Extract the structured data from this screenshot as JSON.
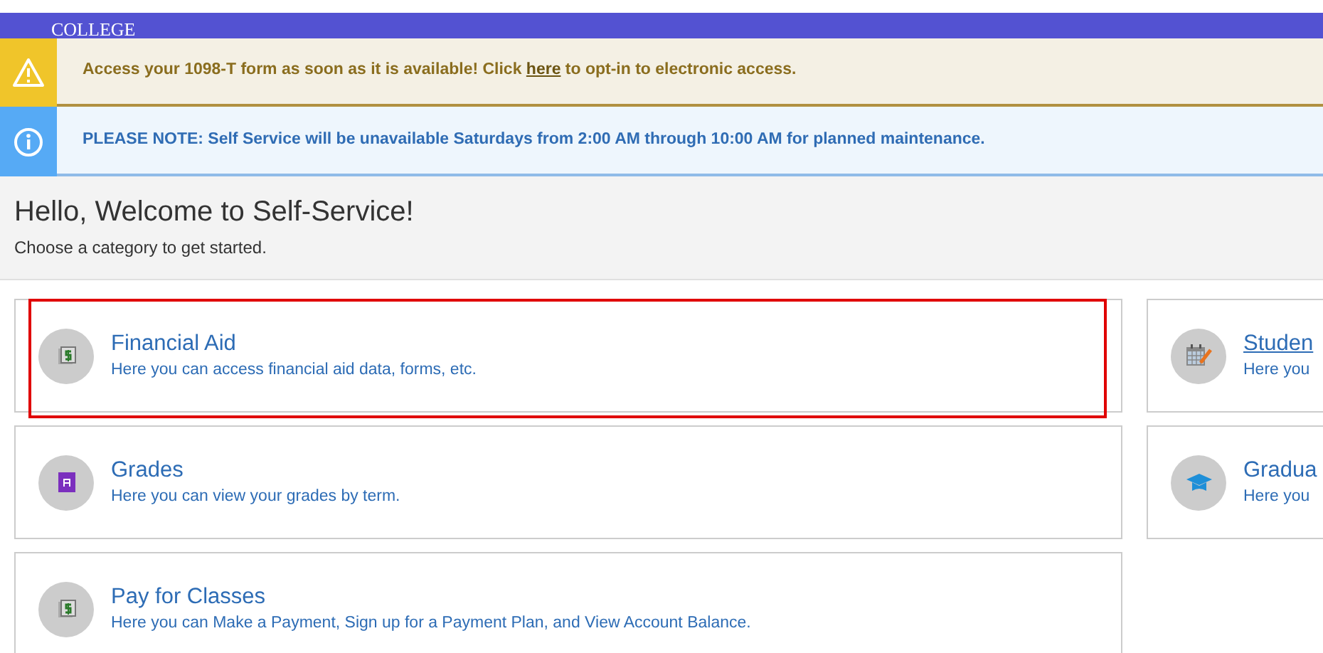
{
  "header": {
    "logo_text": "COLLEGE"
  },
  "alerts": [
    {
      "kind": "warning",
      "text": "Access your 1098-T form as soon as it is available! Click ",
      "link": "here",
      "text_after": " to opt-in to electronic access."
    },
    {
      "kind": "info",
      "text": "PLEASE NOTE: Self Service will be unavailable Saturdays from 2:00 AM through 10:00 AM for planned maintenance."
    }
  ],
  "welcome": {
    "title": "Hello, Welcome to Self-Service!",
    "subtitle": "Choose a category to get started."
  },
  "columns": [
    {
      "cards": [
        {
          "kind": "money",
          "title": "Financial Aid",
          "description": "Here you can access financial aid data, forms, etc.",
          "highlighted": true,
          "underlined": false
        },
        {
          "kind": "grade",
          "title": "Grades",
          "description": "Here you can view your grades by term.",
          "highlighted": false,
          "underlined": false
        },
        {
          "kind": "money",
          "title": "Pay for Classes",
          "description": "Here you can Make a Payment, Sign up for a Payment Plan, and View Account Balance.",
          "highlighted": false,
          "underlined": false
        }
      ]
    },
    {
      "cards": [
        {
          "kind": "calendar",
          "title": "Studen",
          "description": "Here you",
          "highlighted": false,
          "underlined": true
        },
        {
          "kind": "cap",
          "title": "Gradua",
          "description": "Here you",
          "highlighted": false,
          "underlined": false
        }
      ]
    }
  ]
}
